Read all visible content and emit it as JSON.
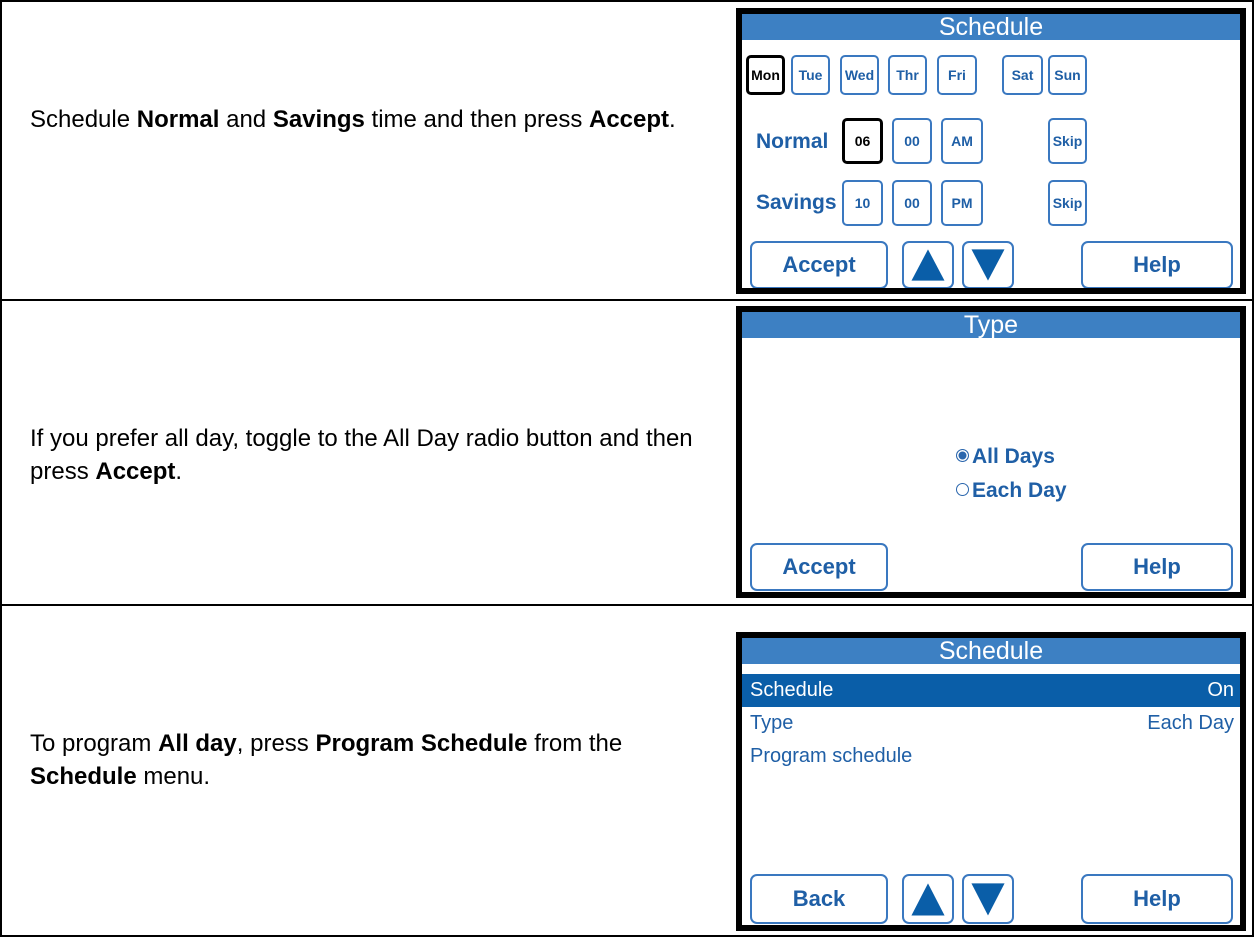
{
  "panels": [
    {
      "instruction": [
        "Schedule ",
        "Normal",
        " and ",
        "Savings",
        " time and then press ",
        "Accept",
        "."
      ],
      "screen": {
        "title": "Schedule",
        "days": [
          "Mon",
          "Tue",
          "Wed",
          "Thr",
          "Fri",
          "Sat",
          "Sun"
        ],
        "selected_day": "Mon",
        "rows": [
          {
            "label": "Normal",
            "hour": "06",
            "minute": "00",
            "ampm": "AM",
            "skip": "Skip"
          },
          {
            "label": "Savings",
            "hour": "10",
            "minute": "00",
            "ampm": "PM",
            "skip": "Skip"
          }
        ],
        "buttons": {
          "accept": "Accept",
          "help": "Help",
          "up_icon": "up-arrow-icon",
          "down_icon": "down-arrow-icon"
        }
      }
    },
    {
      "instruction": [
        "If you prefer all day, toggle to the All Day radio button and then press ",
        "Accept",
        "."
      ],
      "screen": {
        "title": "Type",
        "options": [
          {
            "label": "All Days",
            "selected": true
          },
          {
            "label": "Each Day",
            "selected": false
          }
        ],
        "buttons": {
          "accept": "Accept",
          "help": "Help"
        }
      }
    },
    {
      "instruction": [
        "To program ",
        "All day",
        ", press ",
        "Program Schedule",
        " from the ",
        "Schedule",
        " menu."
      ],
      "screen": {
        "title": "Schedule",
        "items": [
          {
            "label": "Schedule",
            "value": "On",
            "highlighted": true
          },
          {
            "label": "Type",
            "value": "Each Day",
            "highlighted": false
          },
          {
            "label": "Program schedule",
            "value": "",
            "highlighted": false
          }
        ],
        "buttons": {
          "back": "Back",
          "help": "Help"
        }
      }
    }
  ],
  "colors": {
    "title_bar": "#3d80c3",
    "accent": "#1f5fa6",
    "highlight_row": "#0a5ea8",
    "border": "#3a78c0"
  }
}
